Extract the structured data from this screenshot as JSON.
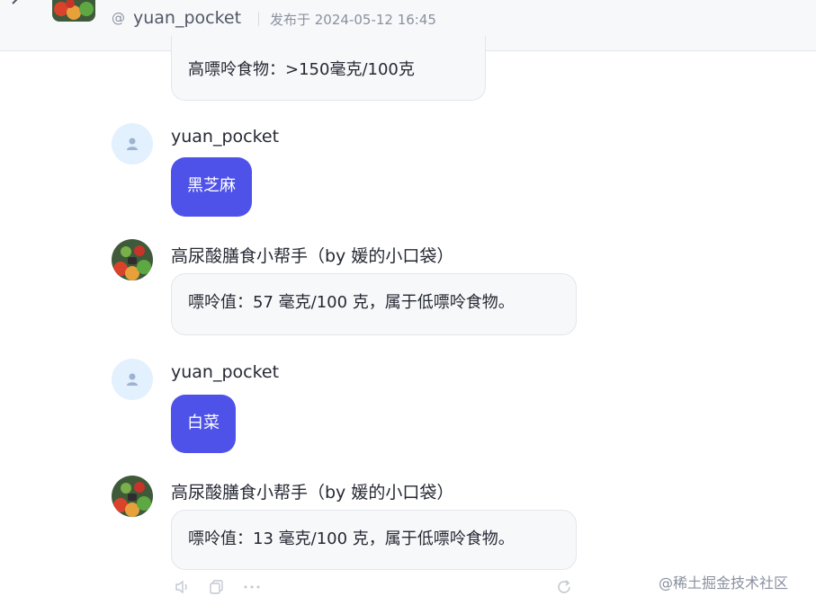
{
  "header": {
    "username": "yuan_pocket",
    "published": "发布于 2024-05-12 16:45",
    "at_symbol": "@"
  },
  "messages": [
    {
      "role": "bot",
      "text": "高嘌呤食物：>150毫克/100克"
    },
    {
      "role": "user",
      "name": "yuan_pocket",
      "text": "黑芝麻"
    },
    {
      "role": "bot",
      "name": "高尿酸膳食小帮手（by 媛的小口袋）",
      "text": "嘌呤值：57 毫克/100 克，属于低嘌呤食物。"
    },
    {
      "role": "user",
      "name": "yuan_pocket",
      "text": "白菜"
    },
    {
      "role": "bot",
      "name": "高尿酸膳食小帮手（by 媛的小口袋）",
      "text": "嘌呤值：13 毫克/100 克，属于低嘌呤食物。"
    }
  ],
  "actions": [
    "speaker-icon",
    "copy-icon",
    "more-icon",
    "refresh-icon"
  ],
  "watermark": "@稀土掘金技术社区",
  "colors": {
    "accent": "#4e52e8",
    "bubble_bg": "#f7f8fa",
    "user_avatar_bg": "#e3f0fd"
  }
}
